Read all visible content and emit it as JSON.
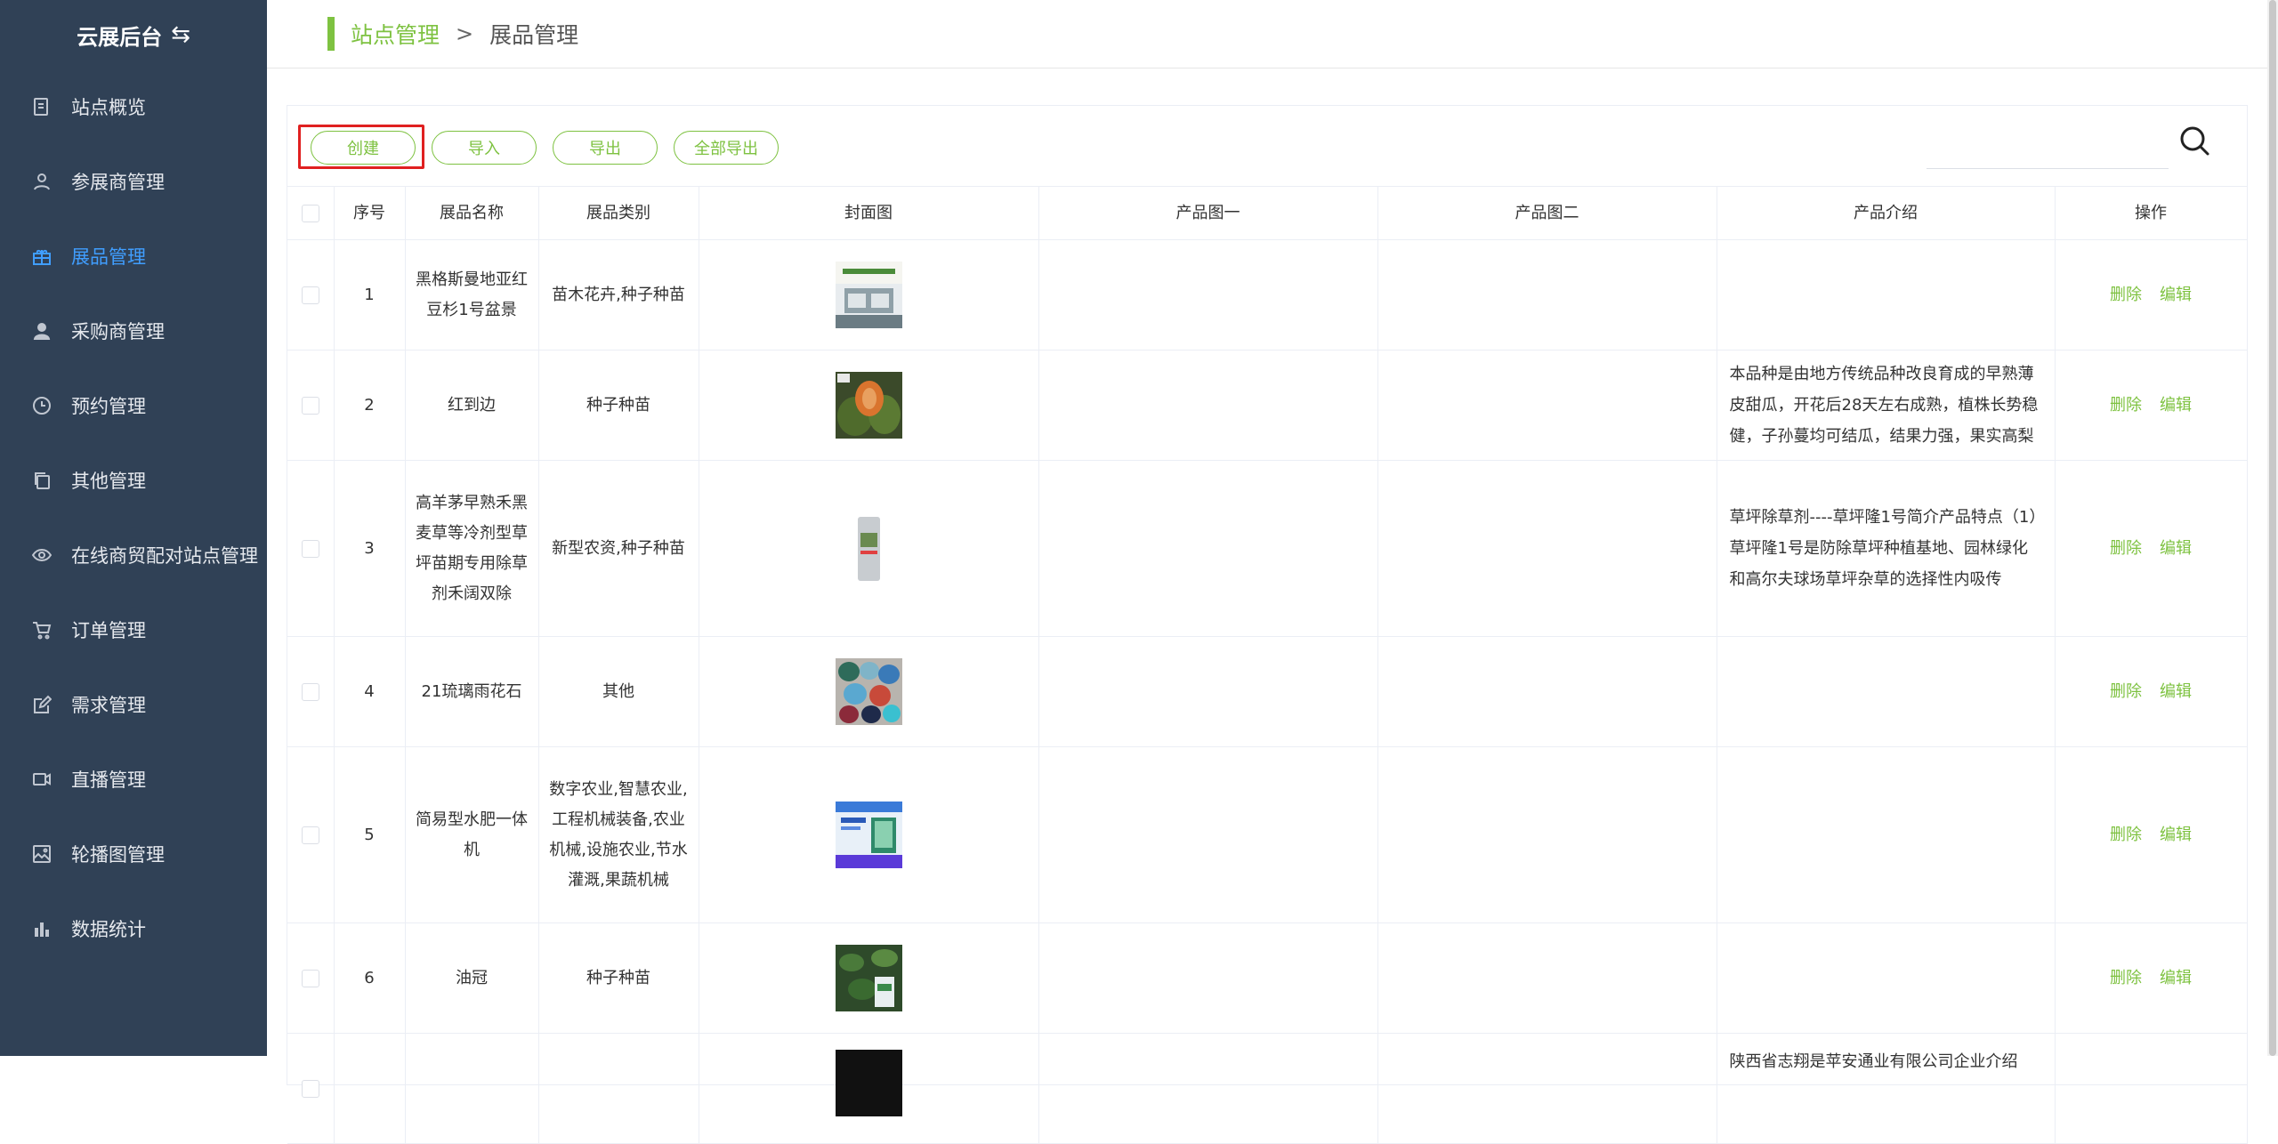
{
  "sidebar": {
    "brand": "云展后台",
    "brand_icon": "swap-icon",
    "items": [
      {
        "label": "站点概览",
        "icon": "document-icon"
      },
      {
        "label": "参展商管理",
        "icon": "user-icon"
      },
      {
        "label": "展品管理",
        "icon": "gift-icon",
        "active": true
      },
      {
        "label": "采购商管理",
        "icon": "person-icon"
      },
      {
        "label": "预约管理",
        "icon": "clock-icon"
      },
      {
        "label": "其他管理",
        "icon": "copy-icon"
      },
      {
        "label": "在线商贸配对站点管理",
        "icon": "eye-icon"
      },
      {
        "label": "订单管理",
        "icon": "cart-icon"
      },
      {
        "label": "需求管理",
        "icon": "edit-icon"
      },
      {
        "label": "直播管理",
        "icon": "video-icon"
      },
      {
        "label": "轮播图管理",
        "icon": "picture-icon"
      },
      {
        "label": "数据统计",
        "icon": "bar-chart-icon"
      }
    ]
  },
  "breadcrumb": {
    "parent": "站点管理",
    "separator": ">",
    "current": "展品管理"
  },
  "toolbar": {
    "create": "创建",
    "import": "导入",
    "export": "导出",
    "export_all": "全部导出",
    "search_placeholder": ""
  },
  "table": {
    "headers": {
      "index": "序号",
      "name": "展品名称",
      "category": "展品类别",
      "cover": "封面图",
      "image1": "产品图一",
      "image2": "产品图二",
      "intro": "产品介绍",
      "actions": "操作"
    },
    "delete_label": "删除",
    "edit_label": "编辑",
    "rows": [
      {
        "index": "1",
        "name": "黑格斯曼地亚红豆杉1号盆景",
        "category": "苗木花卉,种子种苗",
        "intro": ""
      },
      {
        "index": "2",
        "name": "红到边",
        "category": "种子种苗",
        "intro": "本品种是由地方传统品种改良育成的早熟薄皮甜瓜，开花后28天左右成熟，植株长势稳健，子孙蔓均可结瓜，结果力强，果实高梨"
      },
      {
        "index": "3",
        "name": "高羊茅早熟禾黑麦草等冷剂型草坪苗期专用除草剂禾阔双除",
        "category": "新型农资,种子种苗",
        "intro": "草坪除草剂----草坪隆1号简介产品特点（1）草坪隆1号是防除草坪种植基地、园林绿化和高尔夫球场草坪杂草的选择性内吸传"
      },
      {
        "index": "4",
        "name": "21琉璃雨花石",
        "category": "其他",
        "intro": ""
      },
      {
        "index": "5",
        "name": "简易型水肥一体机",
        "category": "数字农业,智慧农业,工程机械装备,农业机械,设施农业,节水灌溉,果蔬机械",
        "intro": ""
      },
      {
        "index": "6",
        "name": "油冠",
        "category": "种子种苗",
        "intro": ""
      },
      {
        "index": "",
        "name": "",
        "category": "",
        "intro": "陕西省志翔是苹安通业有限公司企业介绍"
      }
    ]
  },
  "colors": {
    "accent": "#7ec241",
    "sidebar_bg": "#304156",
    "active": "#409eff",
    "highlight": "#e02020"
  }
}
